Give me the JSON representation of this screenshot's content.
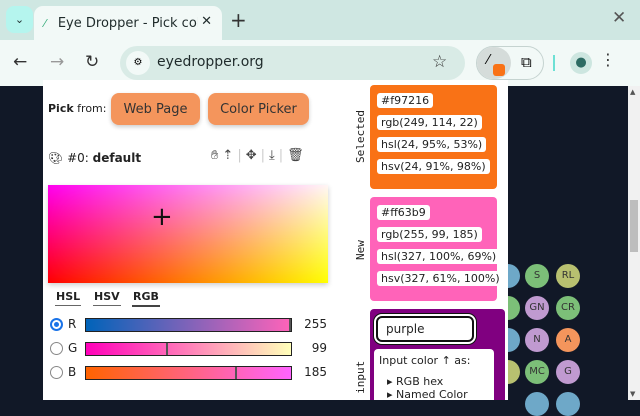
{
  "browser": {
    "tab_title": "Eye Dropper - Pick colors",
    "url": "eyedropper.org"
  },
  "popup": {
    "pick_label_bold": "Pick",
    "pick_label": "from:",
    "web_page_button": "Web Page",
    "color_picker_button": "Color Picker",
    "palette_prefix": "#0:",
    "palette_name": "default",
    "modes": [
      "HSL",
      "HSV",
      "RGB"
    ],
    "channels": [
      {
        "label": "R",
        "value": "255",
        "fraction": 1.0
      },
      {
        "label": "G",
        "value": "99",
        "fraction": 0.388
      },
      {
        "label": "B",
        "value": "185",
        "fraction": 0.725
      }
    ],
    "selected": {
      "label": "Selected",
      "color": "#f97216",
      "values": [
        "#f97216",
        "rgb(249, 114, 22)",
        "hsl(24, 95%, 53%)",
        "hsv(24, 91%, 98%)"
      ]
    },
    "new": {
      "label": "New",
      "color": "#ff63b9",
      "values": [
        "#ff63b9",
        "rgb(255, 99, 185)",
        "hsl(327, 100%, 69%)",
        "hsv(327, 61%, 100%)"
      ]
    },
    "text_input": {
      "label": "Text input",
      "value": "purple",
      "color": "#800080",
      "help_title": "Input color ↑ as:",
      "options": [
        "RGB hex",
        "Named Color"
      ]
    }
  },
  "page_circles": [
    "S",
    "RL",
    "GN",
    "CR",
    "N",
    "A",
    "MC",
    "G"
  ]
}
